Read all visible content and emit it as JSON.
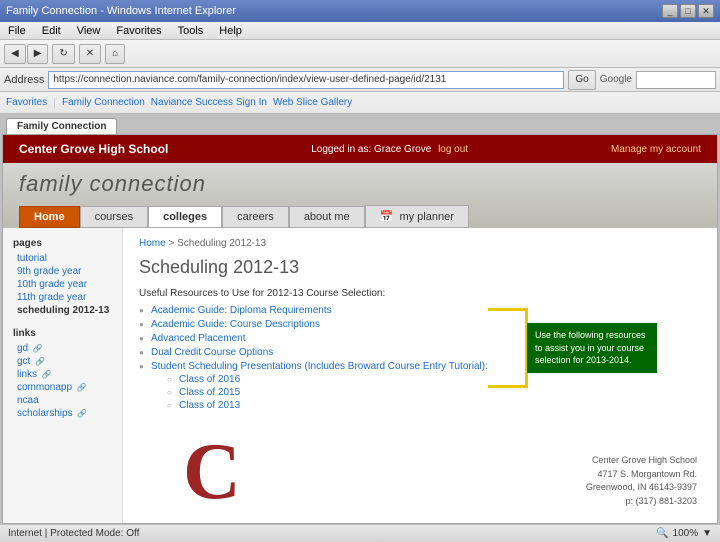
{
  "browser": {
    "title": "Family Connection - Windows Internet Explorer",
    "address": "https://connection.naviance.com/family-connection/index/view-user-defined-page/id/2131",
    "menu_items": [
      "File",
      "Edit",
      "View",
      "Favorites",
      "Tools",
      "Help"
    ],
    "favorites_items": [
      "Favorites",
      "Family Connection",
      "Naviance Success Sign In",
      "Web Slice Gallery"
    ],
    "tab_label": "Family Connection"
  },
  "school_header": {
    "school_name": "Center Grove High School",
    "logged_in": "Logged in as: Grace Grove",
    "log_out": "log out",
    "manage_account": "Manage my account"
  },
  "site_title": "family connection",
  "nav": {
    "home": "Home",
    "courses": "courses",
    "colleges": "colleges",
    "careers": "careers",
    "about_me": "about me",
    "my_planner": "my planner"
  },
  "sidebar": {
    "pages_title": "pages",
    "pages_items": [
      {
        "label": "tutorial",
        "active": false
      },
      {
        "label": "9th grade year",
        "active": false
      },
      {
        "label": "10th grade year",
        "active": false
      },
      {
        "label": "11th grade year",
        "active": false
      },
      {
        "label": "scheduling 2012-13",
        "active": true
      }
    ],
    "links_title": "links",
    "links_items": [
      {
        "label": "gd"
      },
      {
        "label": "gct"
      },
      {
        "label": "links"
      },
      {
        "label": "commonapp"
      },
      {
        "label": "ncaa"
      },
      {
        "label": "scholarships"
      }
    ]
  },
  "breadcrumb": {
    "home": "Home",
    "separator": " > ",
    "current": "Scheduling 2012-13"
  },
  "main": {
    "page_title": "Scheduling 2012-13",
    "resources_label": "Useful Resources to Use for 2012-13 Course Selection:",
    "resources": [
      {
        "label": "Academic Guide: Diploma Requirements",
        "link": true
      },
      {
        "label": "Academic Guide: Course Descriptions",
        "link": true
      },
      {
        "label": "Advanced Placement",
        "link": true
      },
      {
        "label": "Dual Credit Course Options",
        "link": true
      },
      {
        "label": "Student Scheduling Presentations (Includes Broward Course Entry Tutorial):",
        "link": true
      }
    ],
    "sub_items": [
      {
        "label": "Class of 2016"
      },
      {
        "label": "Class of 2015"
      },
      {
        "label": "Class of 2013"
      }
    ]
  },
  "tooltip": {
    "text": "Use the following resources to assist you in your course selection for 2013-2014."
  },
  "school_footer": {
    "name": "Center Grove High School",
    "address1": "4717 S. Morgantown Rd.",
    "address2": "Greenwood, IN 46143-9397",
    "phone": "p: (317) 881-3203"
  },
  "status_bar": {
    "zone": "Internet | Protected Mode: Off",
    "zoom": "100%"
  }
}
